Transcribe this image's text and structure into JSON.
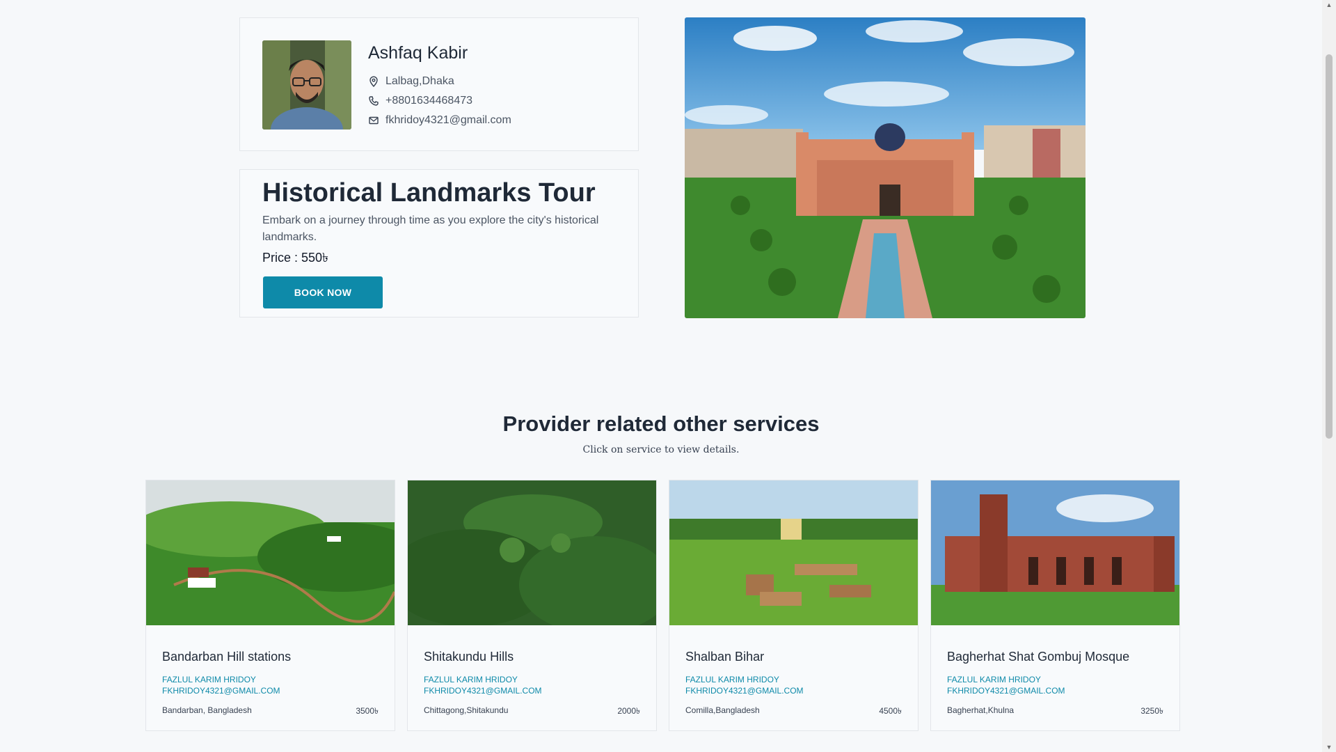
{
  "provider": {
    "name": "Ashfaq Kabir",
    "location": "Lalbag,Dhaka",
    "phone": "+8801634468473",
    "email": "fkhridoy4321@gmail.com"
  },
  "service": {
    "title": "Historical Landmarks Tour",
    "description": "Embark on a journey through time as you explore the city's historical landmarks.",
    "price": "Price : 550৳",
    "book_label": "BOOK NOW"
  },
  "related": {
    "title": "Provider related other services",
    "subtitle": "Click on service to view details.",
    "items": [
      {
        "title": "Bandarban Hill stations",
        "provider": "FAZLUL KARIM HRIDOY",
        "email": "FKHRIDOY4321@GMAIL.COM",
        "place": "Bandarban, Bangladesh",
        "price": "3500৳"
      },
      {
        "title": "Shitakundu Hills",
        "provider": "FAZLUL KARIM HRIDOY",
        "email": "FKHRIDOY4321@GMAIL.COM",
        "place": "Chittagong,Shitakundu",
        "price": "2000৳"
      },
      {
        "title": "Shalban Bihar",
        "provider": "FAZLUL KARIM HRIDOY",
        "email": "FKHRIDOY4321@GMAIL.COM",
        "place": "Comilla,Bangladesh",
        "price": "4500৳"
      },
      {
        "title": "Bagherhat Shat Gombuj Mosque",
        "provider": "FAZLUL KARIM HRIDOY",
        "email": "FKHRIDOY4321@GMAIL.COM",
        "place": "Bagherhat,Khulna",
        "price": "3250৳"
      }
    ]
  },
  "icons": {
    "location": "map-pin-icon",
    "phone": "phone-icon",
    "email": "mail-icon"
  },
  "colors": {
    "accent": "#0e8aa9",
    "background": "#f6f8fa",
    "text": "#1f2937"
  }
}
